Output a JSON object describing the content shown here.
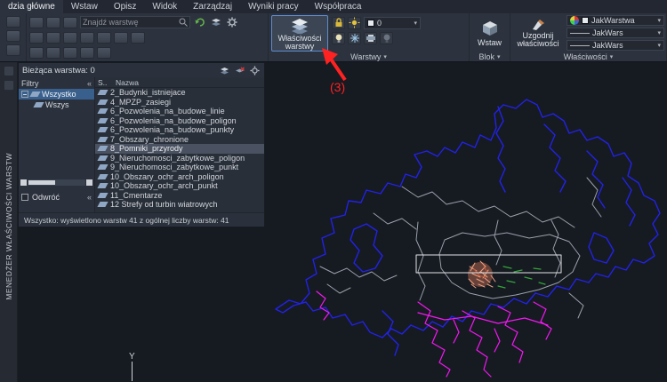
{
  "menu": {
    "tabs": [
      "dzia główne",
      "Wstaw",
      "Opisz",
      "Widok",
      "Zarządzaj",
      "Wyniki pracy",
      "Współpraca"
    ]
  },
  "ribbon": {
    "search": {
      "placeholder": "Znajdź warstwę"
    },
    "layer_properties": {
      "line1": "Właściwości",
      "line2": "warstwy"
    },
    "annotation": "(3)",
    "layer_state_value": "0",
    "insert_label": "Wstaw",
    "match_properties_label": "Uzgodnij właściwości",
    "panels": {
      "layers": "Warstwy",
      "block": "Blok",
      "properties": "Właściwości"
    },
    "properties_rows": {
      "color": "JakWarstwa",
      "lineweight": "JakWars",
      "linetype": "JakWars"
    }
  },
  "side_strip": {
    "title": "MENEDŻER WŁAŚCIWOŚCI WARSTW"
  },
  "palette": {
    "current_layer_label": "Bieżąca warstwa: 0",
    "filters": {
      "label": "Filtry",
      "root": "Wszystko",
      "child": "Wszys"
    },
    "columns": {
      "status": "S..",
      "name": "Nazwa"
    },
    "layers": [
      {
        "name": "2_Budynki_istniejace"
      },
      {
        "name": "4_MPZP_zasiegi"
      },
      {
        "name": "6_Pozwolenia_na_budowe_linie"
      },
      {
        "name": "6_Pozwolenia_na_budowe_poligon"
      },
      {
        "name": "6_Pozwolenia_na_budowe_punkty"
      },
      {
        "name": "7_Obszary_chronione"
      },
      {
        "name": "8_Pomniki_przyrody"
      },
      {
        "name": "9_Nieruchomosci_zabytkowe_poligon"
      },
      {
        "name": "9_Nieruchomosci_zabytkowe_punkt"
      },
      {
        "name": "10_Obszary_ochr_arch_poligon"
      },
      {
        "name": "10_Obszary_ochr_arch_punkt"
      },
      {
        "name": "11_Cmentarze"
      },
      {
        "name": "12 Strefy od turbin wiatrowych"
      }
    ],
    "invert_label": "Odwróć",
    "status": "Wszystko: wyświetlono warstw 41 z ogólnej liczby warstw: 41"
  },
  "canvas": {
    "axis_label": "Y"
  },
  "glyphs": {
    "caret": "▾",
    "chevrons": "«"
  },
  "colors": {
    "annotation_red": "#ff2222",
    "boundary_blue": "#2222e6",
    "magenta": "#f318f3",
    "gray_line": "#9aa1ab",
    "green": "#35a53b",
    "cluster_orange": "#eda184",
    "highlight_rect": "#e2e5e9"
  }
}
